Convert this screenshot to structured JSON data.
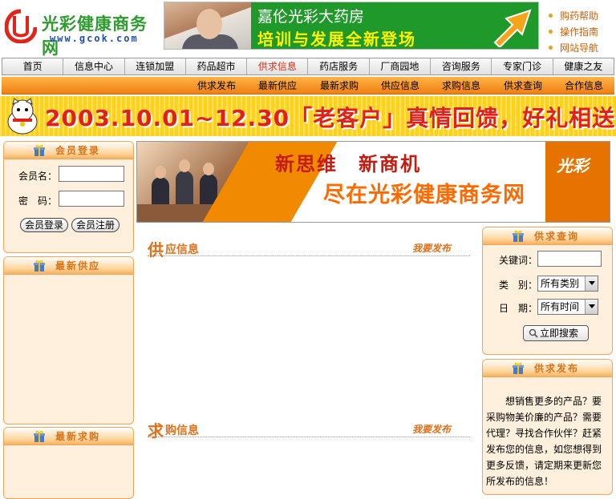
{
  "header": {
    "logo_title": "光彩健康商务网",
    "logo_url": "www.gcok.com",
    "banner": {
      "line1": "嘉伦光彩大药房",
      "line2": "培训与发展全新登场"
    },
    "help_links": [
      "购药帮助",
      "操作指南",
      "网站导航"
    ]
  },
  "nav": {
    "items": [
      "首页",
      "信息中心",
      "连锁加盟",
      "药品超市",
      "供求信息",
      "药店服务",
      "厂商园地",
      "咨询服务",
      "专家门诊",
      "健康之友"
    ],
    "active_index": 4
  },
  "subnav": {
    "items": [
      "供求发布",
      "最新供应",
      "最新求购",
      "供应信息",
      "求购信息",
      "供求查询",
      "合作信息"
    ]
  },
  "promo": {
    "text": "2003.10.01~12.30「老客户」真情回馈，好礼相送。"
  },
  "login": {
    "title": "会员登录",
    "username_label": "会员名：",
    "password_label": "密　码：",
    "login_button": "会员登录",
    "register_button": "会员注册"
  },
  "latest_supply": {
    "title": "最新供应"
  },
  "latest_demand": {
    "title": "最新求购"
  },
  "main_ad": {
    "line1": "新思维　新商机",
    "line2": "尽在光彩健康商务网",
    "brand": "光彩"
  },
  "supply_section": {
    "big": "供",
    "small": "应信息",
    "publish": "我要发布"
  },
  "demand_section": {
    "big": "求",
    "small": "购信息",
    "publish": "我要发布"
  },
  "search": {
    "title": "供求查询",
    "keyword_label": "关键词：",
    "category_label": "类　别：",
    "category_value": "所有类别",
    "date_label": "日　期：",
    "date_value": "所有时间",
    "button": "立即搜索"
  },
  "publish_panel": {
    "title": "供求发布",
    "text": "想销售更多的产品？要采购物美价廉的产品？需要代理？寻找合作伙伴？赶紧发布您的信息，如您想得到更多反馈，请定期来更新您所发布的信息！"
  },
  "colors": {
    "accent_orange": "#ee7f12",
    "logo_green": "#2e9b2e",
    "panel_bg": "#fff0de",
    "promo_yellow": "#ffd21a"
  }
}
